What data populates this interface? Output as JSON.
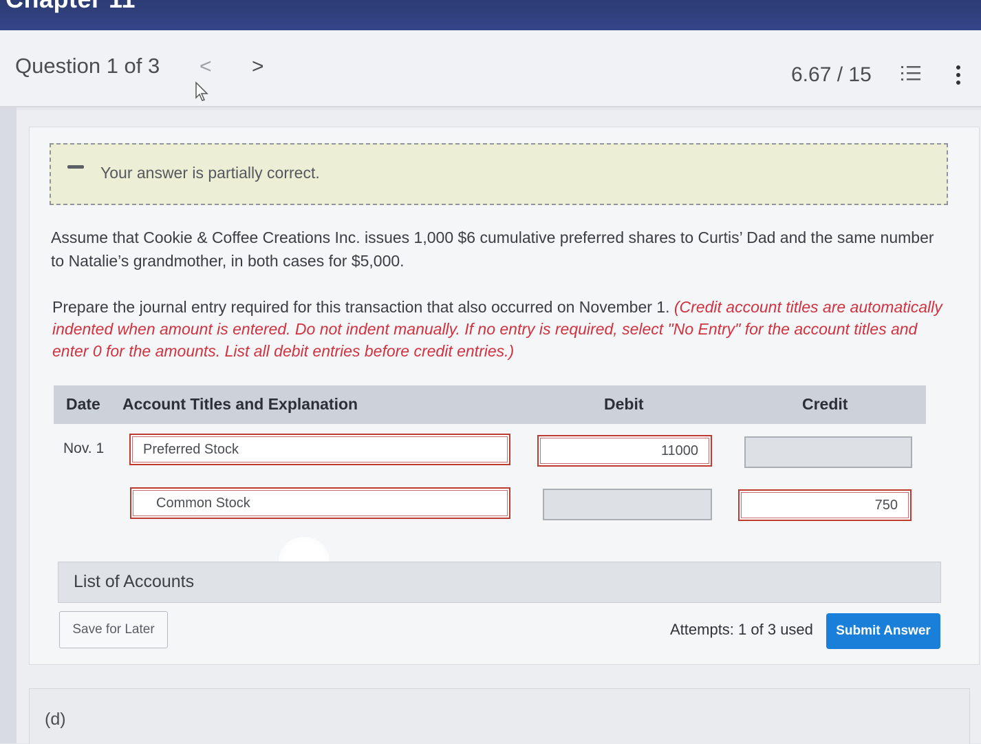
{
  "topbar": {
    "title": "Chapter 11"
  },
  "header": {
    "question_label": "Question 1 of 3",
    "prev_icon": "chevron-left-icon",
    "next_icon": "chevron-right-icon",
    "prev_glyph": "<",
    "next_glyph": ">",
    "score": "6.67 / 15",
    "list_icon": "list-icon",
    "menu_icon": "kebab-menu-icon"
  },
  "feedback": {
    "text": "Your answer is partially correct."
  },
  "question": {
    "paragraph1": "Assume that Cookie & Coffee Creations Inc. issues 1,000 $6 cumulative preferred shares to Curtis’ Dad and the same number to Natalie’s grandmother, in both cases for $5,000.",
    "paragraph2_plain": "Prepare the journal entry required for this transaction that also occurred on November 1. ",
    "paragraph2_instructions": "(Credit account titles are automatically indented when amount is entered. Do not indent manually. If no entry is required, select \"No Entry\" for the account titles and enter 0 for the amounts. List all debit entries before credit entries.)"
  },
  "table": {
    "headers": {
      "date": "Date",
      "account": "Account Titles and Explanation",
      "debit": "Debit",
      "credit": "Credit"
    },
    "rows": [
      {
        "date": "Nov. 1",
        "account": "Preferred Stock",
        "debit": "11000",
        "credit": ""
      },
      {
        "date": "",
        "account": "Common Stock",
        "debit": "",
        "credit": "750"
      }
    ]
  },
  "accounts": {
    "label": "List of Accounts"
  },
  "footer": {
    "save_label": "Save for Later",
    "attempts": "Attempts: 1 of 3 used",
    "submit_label": "Submit Answer"
  },
  "next_part": {
    "label": "(d)"
  },
  "colors": {
    "accent": "#1a7fd8",
    "error_border": "#c0392f",
    "instruction_red": "#d0323f",
    "topbar": "#2d3c73"
  }
}
